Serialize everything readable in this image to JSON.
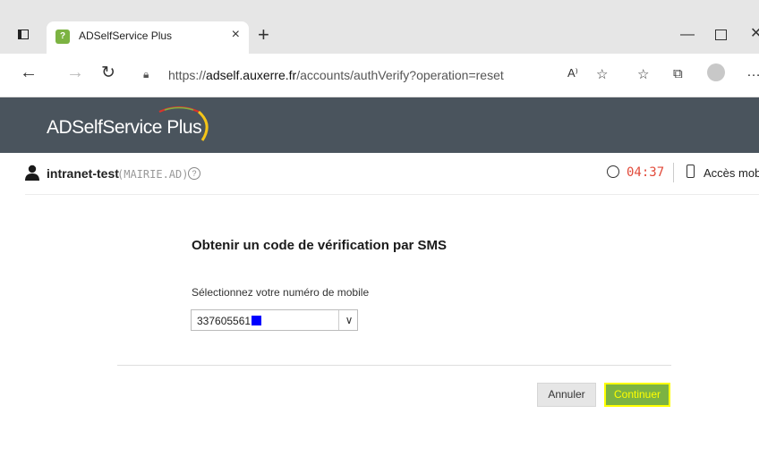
{
  "browser": {
    "tab_title": "ADSelfService Plus",
    "tab_close": "×",
    "new_tab": "+",
    "url_prefix": "https://",
    "url_domain": "adself.auxerre.fr",
    "url_path": "/accounts/authVerify?operation=reset",
    "icons": [
      "window-icon",
      "back-icon",
      "forward-icon",
      "reload-icon",
      "lock-icon",
      "read-aloud-icon",
      "favorite-add-icon",
      "favorites-icon",
      "collections-icon",
      "profile-icon",
      "more-icon",
      "minimize-icon",
      "maximize-icon",
      "close-icon"
    ],
    "read_aloud_glyph": "A⁾",
    "more_glyph": "…"
  },
  "app": {
    "brand": "ADSelfService Plus",
    "brand_colors": {
      "bar": "#4a545d",
      "arc_green": "#7cb342",
      "arc_yellow": "#f5c518",
      "arc_red": "#d9342b"
    }
  },
  "user": {
    "name": "intranet-test",
    "domain": "(MAIRIE.AD)",
    "help": "?",
    "timer": "04:37",
    "mobile_access": "Accès mobile"
  },
  "form": {
    "heading": "Obtenir un code de vérification par SMS",
    "select_label": "Sélectionnez votre numéro de mobile",
    "selected_number": "337605561",
    "cancel_label": "Annuler",
    "continue_label": "Continuer",
    "colors": {
      "continue_bg": "#7cb342",
      "continue_highlight": "#ffff00",
      "timer": "#e24a3a",
      "mask": "#0000ff"
    }
  }
}
